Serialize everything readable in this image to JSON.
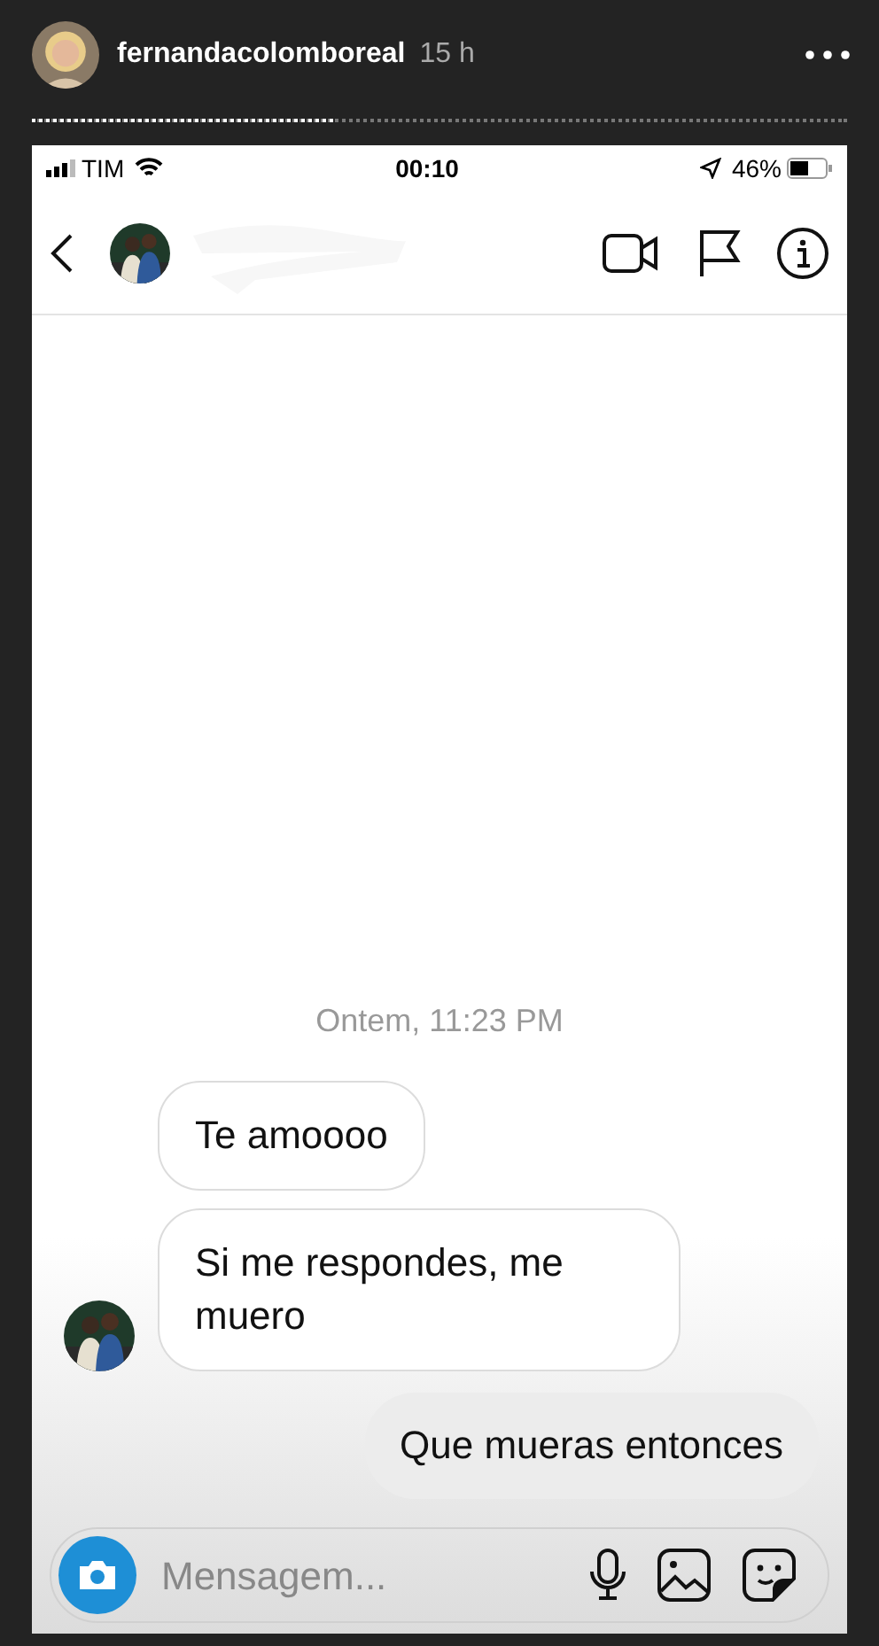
{
  "story": {
    "username": "fernandacolomboreal",
    "time": "15 h",
    "progress": {
      "level": 0.37
    }
  },
  "status_bar": {
    "carrier": "TIM",
    "time": "00:10",
    "battery": "46%"
  },
  "chat": {
    "messages": [
      {
        "kind": "timestamp",
        "text": "Ontem, 11:23 PM"
      },
      {
        "kind": "received",
        "text": "Te amoooo",
        "avatar": false
      },
      {
        "kind": "received",
        "text": "Si me respondes, me muero",
        "avatar": true
      },
      {
        "kind": "sent",
        "text": "Que mueras entonces"
      }
    ]
  },
  "composer": {
    "placeholder": "Mensagem..."
  }
}
